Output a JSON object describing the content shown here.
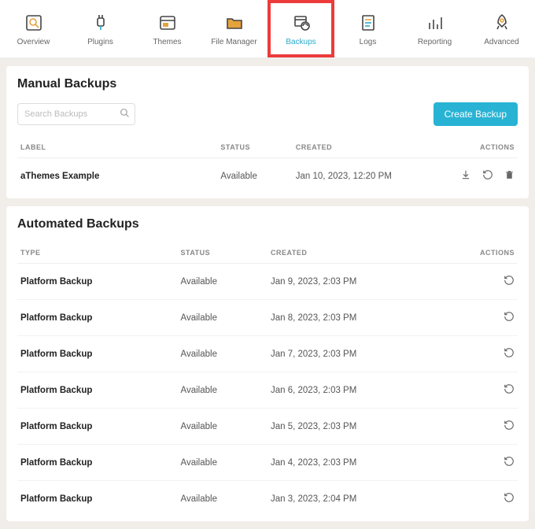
{
  "nav": [
    {
      "label": "Overview",
      "icon": "overview",
      "active": false
    },
    {
      "label": "Plugins",
      "icon": "plug",
      "active": false
    },
    {
      "label": "Themes",
      "icon": "window",
      "active": false
    },
    {
      "label": "File Manager",
      "icon": "folder",
      "active": false
    },
    {
      "label": "Backups",
      "icon": "backup",
      "active": true
    },
    {
      "label": "Logs",
      "icon": "logs",
      "active": false
    },
    {
      "label": "Reporting",
      "icon": "bars",
      "active": false
    },
    {
      "label": "Advanced",
      "icon": "rocket",
      "active": false
    }
  ],
  "manual": {
    "title": "Manual Backups",
    "search_placeholder": "Search Backups",
    "create_label": "Create Backup",
    "columns": {
      "label": "LABEL",
      "status": "STATUS",
      "created": "CREATED",
      "actions": "ACTIONS"
    },
    "rows": [
      {
        "label": "aThemes Example",
        "status": "Available",
        "created": "Jan 10, 2023, 12:20 PM"
      }
    ]
  },
  "automated": {
    "title": "Automated Backups",
    "columns": {
      "type": "TYPE",
      "status": "STATUS",
      "created": "CREATED",
      "actions": "ACTIONS"
    },
    "rows": [
      {
        "type": "Platform Backup",
        "status": "Available",
        "created": "Jan 9, 2023, 2:03 PM"
      },
      {
        "type": "Platform Backup",
        "status": "Available",
        "created": "Jan 8, 2023, 2:03 PM"
      },
      {
        "type": "Platform Backup",
        "status": "Available",
        "created": "Jan 7, 2023, 2:03 PM"
      },
      {
        "type": "Platform Backup",
        "status": "Available",
        "created": "Jan 6, 2023, 2:03 PM"
      },
      {
        "type": "Platform Backup",
        "status": "Available",
        "created": "Jan 5, 2023, 2:03 PM"
      },
      {
        "type": "Platform Backup",
        "status": "Available",
        "created": "Jan 4, 2023, 2:03 PM"
      },
      {
        "type": "Platform Backup",
        "status": "Available",
        "created": "Jan 3, 2023, 2:04 PM"
      }
    ]
  }
}
